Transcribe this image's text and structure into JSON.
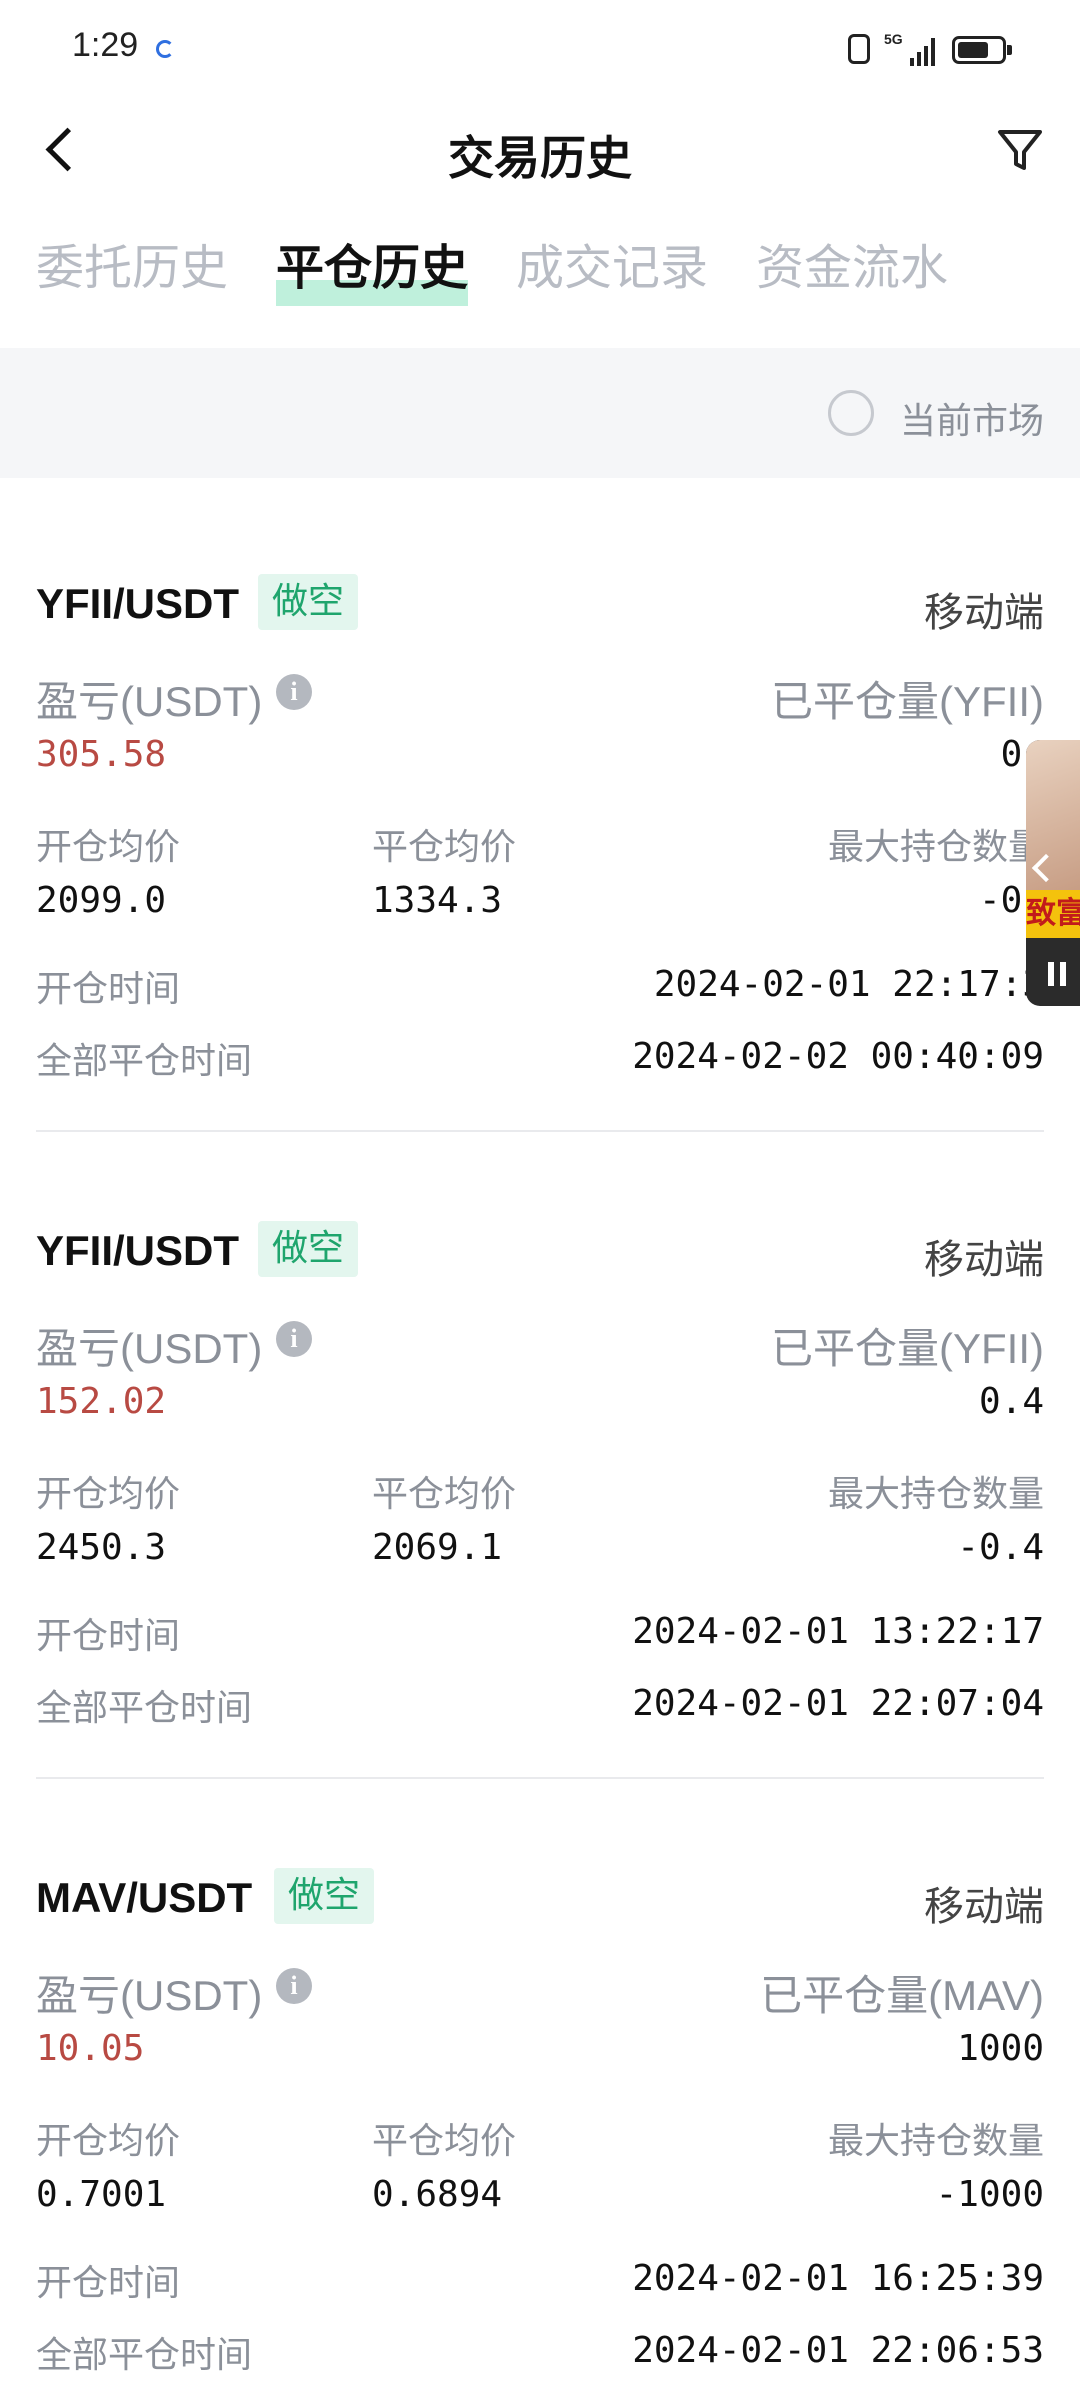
{
  "status": {
    "time": "1:29",
    "network": "5G"
  },
  "header": {
    "title": "交易历史"
  },
  "tabs": [
    {
      "label": "委托历史",
      "active": false
    },
    {
      "label": "平仓历史",
      "active": true
    },
    {
      "label": "成交记录",
      "active": false
    },
    {
      "label": "资金流水",
      "active": false
    }
  ],
  "filter": {
    "current_market_label": "当前市场",
    "checked": false
  },
  "labels": {
    "open_avg": "开仓均价",
    "close_avg": "平仓均价",
    "max_position": "最大持仓数量",
    "open_time": "开仓时间",
    "full_close_time": "全部平仓时间"
  },
  "records": [
    {
      "pair": "YFII/USDT",
      "side": "做空",
      "source": "移动端",
      "pnl_label": "盈亏(USDT)",
      "closed_label": "已平仓量(YFII)",
      "pnl": "305.58",
      "closed_qty": "0.",
      "open_avg": "2099.0",
      "close_avg": "1334.3",
      "max_position": "-0.",
      "open_time": "2024-02-01 22:17:3",
      "full_close_time": "2024-02-02 00:40:09"
    },
    {
      "pair": "YFII/USDT",
      "side": "做空",
      "source": "移动端",
      "pnl_label": "盈亏(USDT)",
      "closed_label": "已平仓量(YFII)",
      "pnl": "152.02",
      "closed_qty": "0.4",
      "open_avg": "2450.3",
      "close_avg": "2069.1",
      "max_position": "-0.4",
      "open_time": "2024-02-01 13:22:17",
      "full_close_time": "2024-02-01 22:07:04"
    },
    {
      "pair": "MAV/USDT",
      "side": "做空",
      "source": "移动端",
      "pnl_label": "盈亏(USDT)",
      "closed_label": "已平仓量(MAV)",
      "pnl": "10.05",
      "closed_qty": "1000",
      "open_avg": "0.7001",
      "close_avg": "0.6894",
      "max_position": "-1000",
      "open_time": "2024-02-01 16:25:39",
      "full_close_time": "2024-02-01 22:06:53"
    }
  ],
  "floating_video": {
    "caption": "致富"
  },
  "colors": {
    "profit": "#b84a43",
    "short_tag_bg": "#e3f6ee",
    "short_tag_text": "#1fa56d",
    "tab_highlight": "#bff0dc"
  }
}
